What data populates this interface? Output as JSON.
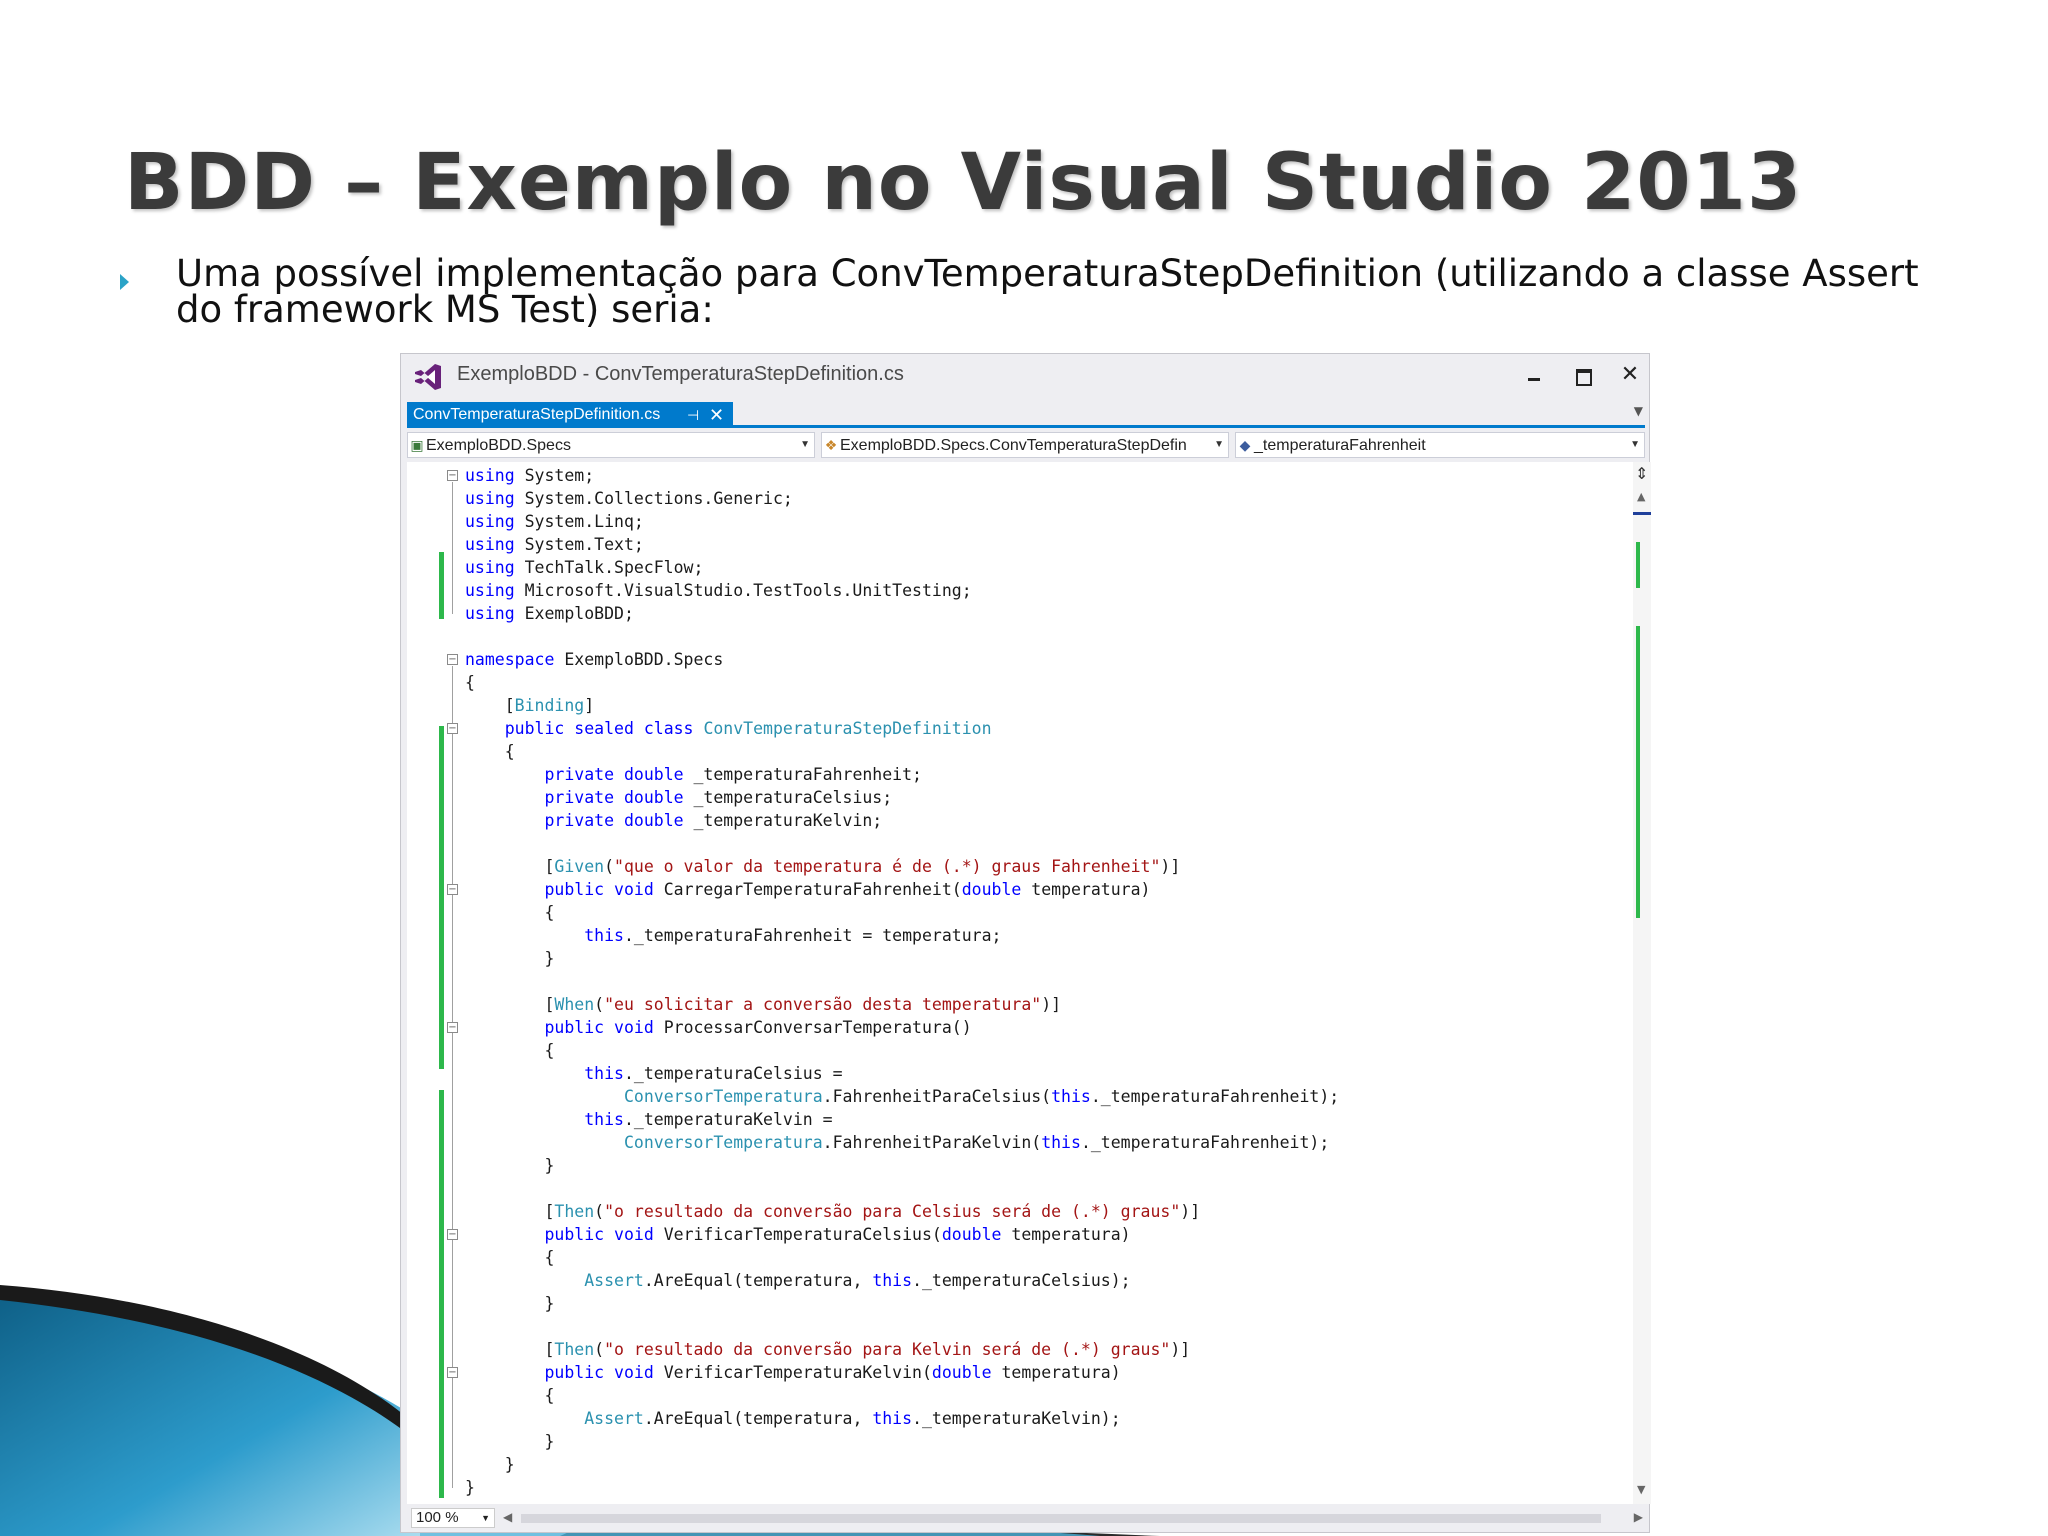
{
  "slide": {
    "title": "BDD – Exemplo no Visual Studio 2013",
    "bullet": "Uma possível implementação para ConvTemperaturaStepDefinition (utilizando a classe Assert do framework MS Test) seria:"
  },
  "window": {
    "title": "ExemploBDD - ConvTemperaturaStepDefinition.cs",
    "close_glyph": "✕"
  },
  "tab": {
    "label": "ConvTemperaturaStepDefinition.cs",
    "pin_glyph": "⊣",
    "close_glyph": "✕"
  },
  "navbar": {
    "project": "ExemploBDD.Specs",
    "type": "ExemploBDD.Specs.ConvTemperaturaStepDefin",
    "member": "_temperaturaFahrenheit"
  },
  "status": {
    "zoom": "100 %"
  },
  "colors": {
    "accent": "#007acc",
    "keyword": "#0000ff",
    "type": "#2b91af",
    "string": "#a31515",
    "change_marker": "#2db84b"
  },
  "code": [
    [
      [
        "kw",
        "using"
      ],
      [
        "t",
        " System;"
      ]
    ],
    [
      [
        "kw",
        "using"
      ],
      [
        "t",
        " System.Collections.Generic;"
      ]
    ],
    [
      [
        "kw",
        "using"
      ],
      [
        "t",
        " System.Linq;"
      ]
    ],
    [
      [
        "kw",
        "using"
      ],
      [
        "t",
        " System.Text;"
      ]
    ],
    [
      [
        "kw",
        "using"
      ],
      [
        "t",
        " TechTalk.SpecFlow;"
      ]
    ],
    [
      [
        "kw",
        "using"
      ],
      [
        "t",
        " Microsoft.VisualStudio.TestTools.UnitTesting;"
      ]
    ],
    [
      [
        "kw",
        "using"
      ],
      [
        "t",
        " ExemploBDD;"
      ]
    ],
    [],
    [
      [
        "kw",
        "namespace"
      ],
      [
        "t",
        " ExemploBDD.Specs"
      ]
    ],
    [
      [
        "t",
        "{"
      ]
    ],
    [
      [
        "t",
        "    ["
      ],
      [
        "ty",
        "Binding"
      ],
      [
        "t",
        "]"
      ]
    ],
    [
      [
        "t",
        "    "
      ],
      [
        "kw",
        "public sealed class"
      ],
      [
        "t",
        " "
      ],
      [
        "ty",
        "ConvTemperaturaStepDefinition"
      ]
    ],
    [
      [
        "t",
        "    {"
      ]
    ],
    [
      [
        "t",
        "        "
      ],
      [
        "kw",
        "private double"
      ],
      [
        "t",
        " _temperaturaFahrenheit;"
      ]
    ],
    [
      [
        "t",
        "        "
      ],
      [
        "kw",
        "private double"
      ],
      [
        "t",
        " _temperaturaCelsius;"
      ]
    ],
    [
      [
        "t",
        "        "
      ],
      [
        "kw",
        "private double"
      ],
      [
        "t",
        " _temperaturaKelvin;"
      ]
    ],
    [],
    [
      [
        "t",
        "        ["
      ],
      [
        "ty",
        "Given"
      ],
      [
        "t",
        "("
      ],
      [
        "st",
        "\"que o valor da temperatura é de (.*) graus Fahrenheit\""
      ],
      [
        "t",
        ")]"
      ]
    ],
    [
      [
        "t",
        "        "
      ],
      [
        "kw",
        "public void"
      ],
      [
        "t",
        " CarregarTemperaturaFahrenheit("
      ],
      [
        "kw",
        "double"
      ],
      [
        "t",
        " temperatura)"
      ]
    ],
    [
      [
        "t",
        "        {"
      ]
    ],
    [
      [
        "t",
        "            "
      ],
      [
        "kw",
        "this"
      ],
      [
        "t",
        "._temperaturaFahrenheit = temperatura;"
      ]
    ],
    [
      [
        "t",
        "        }"
      ]
    ],
    [],
    [
      [
        "t",
        "        ["
      ],
      [
        "ty",
        "When"
      ],
      [
        "t",
        "("
      ],
      [
        "st",
        "\"eu solicitar a conversão desta temperatura\""
      ],
      [
        "t",
        ")]"
      ]
    ],
    [
      [
        "t",
        "        "
      ],
      [
        "kw",
        "public void"
      ],
      [
        "t",
        " ProcessarConversarTemperatura()"
      ]
    ],
    [
      [
        "t",
        "        {"
      ]
    ],
    [
      [
        "t",
        "            "
      ],
      [
        "kw",
        "this"
      ],
      [
        "t",
        "._temperaturaCelsius ="
      ]
    ],
    [
      [
        "t",
        "                "
      ],
      [
        "ty",
        "ConversorTemperatura"
      ],
      [
        "t",
        ".FahrenheitParaCelsius("
      ],
      [
        "kw",
        "this"
      ],
      [
        "t",
        "._temperaturaFahrenheit);"
      ]
    ],
    [
      [
        "t",
        "            "
      ],
      [
        "kw",
        "this"
      ],
      [
        "t",
        "._temperaturaKelvin ="
      ]
    ],
    [
      [
        "t",
        "                "
      ],
      [
        "ty",
        "ConversorTemperatura"
      ],
      [
        "t",
        ".FahrenheitParaKelvin("
      ],
      [
        "kw",
        "this"
      ],
      [
        "t",
        "._temperaturaFahrenheit);"
      ]
    ],
    [
      [
        "t",
        "        }"
      ]
    ],
    [],
    [
      [
        "t",
        "        ["
      ],
      [
        "ty",
        "Then"
      ],
      [
        "t",
        "("
      ],
      [
        "st",
        "\"o resultado da conversão para Celsius será de (.*) graus\""
      ],
      [
        "t",
        ")]"
      ]
    ],
    [
      [
        "t",
        "        "
      ],
      [
        "kw",
        "public void"
      ],
      [
        "t",
        " VerificarTemperaturaCelsius("
      ],
      [
        "kw",
        "double"
      ],
      [
        "t",
        " temperatura)"
      ]
    ],
    [
      [
        "t",
        "        {"
      ]
    ],
    [
      [
        "t",
        "            "
      ],
      [
        "ty",
        "Assert"
      ],
      [
        "t",
        ".AreEqual(temperatura, "
      ],
      [
        "kw",
        "this"
      ],
      [
        "t",
        "._temperaturaCelsius);"
      ]
    ],
    [
      [
        "t",
        "        }"
      ]
    ],
    [],
    [
      [
        "t",
        "        ["
      ],
      [
        "ty",
        "Then"
      ],
      [
        "t",
        "("
      ],
      [
        "st",
        "\"o resultado da conversão para Kelvin será de (.*) graus\""
      ],
      [
        "t",
        ")]"
      ]
    ],
    [
      [
        "t",
        "        "
      ],
      [
        "kw",
        "public void"
      ],
      [
        "t",
        " VerificarTemperaturaKelvin("
      ],
      [
        "kw",
        "double"
      ],
      [
        "t",
        " temperatura)"
      ]
    ],
    [
      [
        "t",
        "        {"
      ]
    ],
    [
      [
        "t",
        "            "
      ],
      [
        "ty",
        "Assert"
      ],
      [
        "t",
        ".AreEqual(temperatura, "
      ],
      [
        "kw",
        "this"
      ],
      [
        "t",
        "._temperaturaKelvin);"
      ]
    ],
    [
      [
        "t",
        "        }"
      ]
    ],
    [
      [
        "t",
        "    }"
      ]
    ],
    [
      [
        "t",
        "}"
      ]
    ]
  ]
}
